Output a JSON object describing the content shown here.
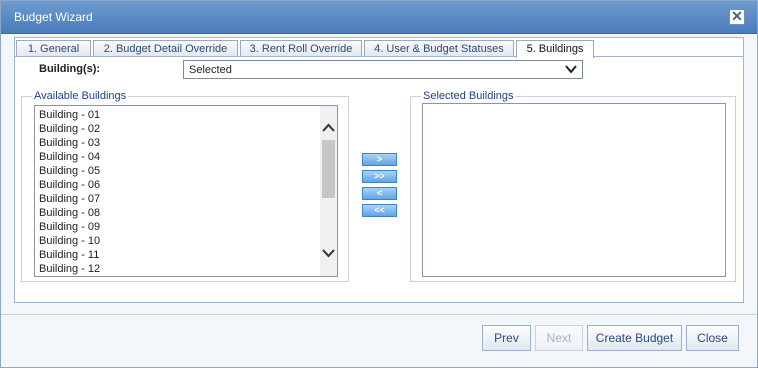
{
  "dialog": {
    "title": "Budget Wizard"
  },
  "tabs": [
    {
      "label": "1. General"
    },
    {
      "label": "2. Budget Detail Override"
    },
    {
      "label": "3. Rent Roll Override"
    },
    {
      "label": "4. User & Budget Statuses"
    },
    {
      "label": "5. Buildings",
      "active": true
    }
  ],
  "buildings_filter": {
    "label": "Building(s):",
    "selected": "Selected"
  },
  "available": {
    "legend": "Available Buildings",
    "items": [
      "Building - 01",
      "Building - 02",
      "Building - 03",
      "Building - 04",
      "Building - 05",
      "Building - 06",
      "Building - 07",
      "Building - 08",
      "Building - 09",
      "Building - 10",
      "Building - 11",
      "Building - 12"
    ]
  },
  "selected": {
    "legend": "Selected Buildings",
    "items": []
  },
  "move_buttons": {
    "add": ">",
    "add_all": ">>",
    "remove": "<",
    "remove_all": "<<"
  },
  "footer": {
    "prev": "Prev",
    "next": "Next",
    "create": "Create Budget",
    "close": "Close"
  },
  "icons": {
    "close": "close-icon",
    "dropdown": "chevron-down-icon",
    "scroll_up": "chevron-up-icon",
    "scroll_down": "chevron-down-icon"
  }
}
